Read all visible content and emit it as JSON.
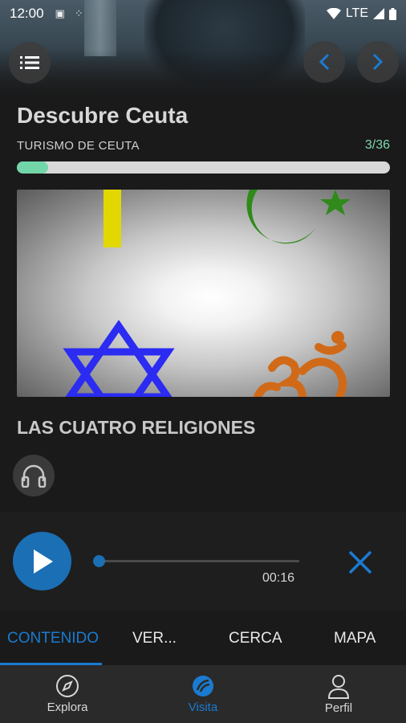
{
  "status_bar": {
    "time": "12:00",
    "network": "LTE",
    "icons": [
      "sim-icon",
      "notification-icon",
      "wifi-icon",
      "signal-icon",
      "battery-icon"
    ]
  },
  "header": {
    "title": "Descubre Ceuta",
    "subtitle": "TURISMO DE CEUTA",
    "counter": "3/36",
    "progress_fraction": 0.083,
    "accent_color": "#72d6a9"
  },
  "content": {
    "image_description_icons": [
      "star-of-david-icon",
      "crescent-star-icon",
      "om-symbol-icon",
      "cross-icon"
    ],
    "section_title": "LAS CUATRO RELIGIONES"
  },
  "player": {
    "elapsed": "00:16",
    "progress_fraction": 0.0,
    "button_color": "#1b6fb5"
  },
  "tabs": [
    {
      "label": "CONTENIDO",
      "active": true
    },
    {
      "label": "VER...",
      "active": false
    },
    {
      "label": "CERCA",
      "active": false
    },
    {
      "label": "MAPA",
      "active": false
    }
  ],
  "bottom_nav": [
    {
      "label": "Explora",
      "icon": "compass-icon",
      "active": false
    },
    {
      "label": "Visita",
      "icon": "visit-icon",
      "active": true
    },
    {
      "label": "Perfil",
      "icon": "profile-icon",
      "active": false
    }
  ]
}
